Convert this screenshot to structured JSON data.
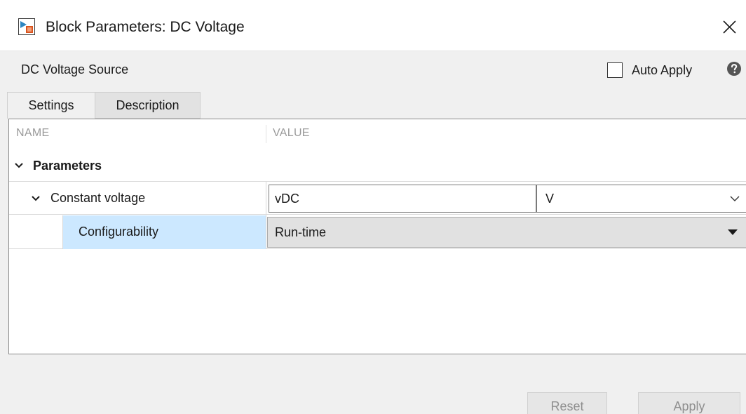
{
  "window": {
    "title": "Block Parameters: DC Voltage",
    "icon": "simulink-block-icon",
    "close_icon": "close-icon"
  },
  "header": {
    "source_name": "DC Voltage Source",
    "auto_apply_label": "Auto Apply",
    "auto_apply_checked": false,
    "help_icon": "help-icon"
  },
  "tabs": [
    {
      "label": "Settings",
      "active": true
    },
    {
      "label": "Description",
      "active": false
    }
  ],
  "table": {
    "columns": {
      "name": "NAME",
      "value": "VALUE"
    },
    "group": {
      "label": "Parameters",
      "expanded": true
    },
    "rows": [
      {
        "label": "Constant voltage",
        "value": "vDC",
        "unit": "V",
        "expanded": true
      },
      {
        "label": "Configurability",
        "value": "Run-time",
        "selected": true
      }
    ]
  },
  "buttons": {
    "reset": "Reset",
    "apply": "Apply"
  },
  "colors": {
    "selection": "#cce8ff",
    "panel_bg": "#f0f0f0",
    "disabled_text": "#8f8f8f"
  }
}
